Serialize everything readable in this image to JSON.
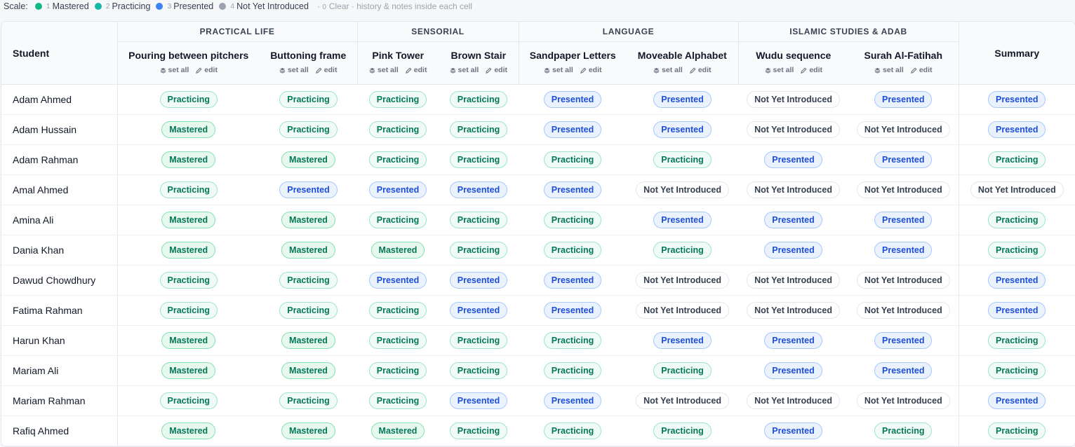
{
  "scale": {
    "label": "Scale:",
    "levels": [
      {
        "num": "1",
        "name": "Mastered",
        "color": "#10b981"
      },
      {
        "num": "2",
        "name": "Practicing",
        "color": "#14b8a6"
      },
      {
        "num": "3",
        "name": "Presented",
        "color": "#3b82f6"
      },
      {
        "num": "4",
        "name": "Not Yet Introduced",
        "color": "#9ca3af"
      }
    ],
    "hint_prefix": "·",
    "hint_key": "0",
    "hint_text": "Clear · history & notes inside each cell"
  },
  "table": {
    "student_header": "Student",
    "summary_header": "Summary",
    "set_all_label": "set all",
    "edit_label": "edit",
    "groups": [
      {
        "name": "PRACTICAL LIFE",
        "activities": [
          "Pouring between pitchers",
          "Buttoning frame"
        ]
      },
      {
        "name": "SENSORIAL",
        "activities": [
          "Pink Tower",
          "Brown Stair"
        ]
      },
      {
        "name": "LANGUAGE",
        "activities": [
          "Sandpaper Letters",
          "Moveable Alphabet"
        ]
      },
      {
        "name": "ISLAMIC STUDIES & ADAB",
        "activities": [
          "Wudu sequence",
          "Surah Al-Fatihah"
        ]
      }
    ],
    "rows": [
      {
        "student": "Adam Ahmed",
        "cells": [
          "Practicing",
          "Practicing",
          "Practicing",
          "Practicing",
          "Presented",
          "Presented",
          "Not Yet Introduced",
          "Presented"
        ],
        "summary": "Presented"
      },
      {
        "student": "Adam Hussain",
        "cells": [
          "Mastered",
          "Practicing",
          "Practicing",
          "Practicing",
          "Presented",
          "Presented",
          "Not Yet Introduced",
          "Not Yet Introduced"
        ],
        "summary": "Presented"
      },
      {
        "student": "Adam Rahman",
        "cells": [
          "Mastered",
          "Mastered",
          "Practicing",
          "Practicing",
          "Practicing",
          "Practicing",
          "Presented",
          "Presented"
        ],
        "summary": "Practicing"
      },
      {
        "student": "Amal Ahmed",
        "cells": [
          "Practicing",
          "Presented",
          "Presented",
          "Presented",
          "Presented",
          "Not Yet Introduced",
          "Not Yet Introduced",
          "Not Yet Introduced"
        ],
        "summary": "Not Yet Introduced"
      },
      {
        "student": "Amina Ali",
        "cells": [
          "Mastered",
          "Mastered",
          "Practicing",
          "Practicing",
          "Practicing",
          "Presented",
          "Presented",
          "Presented"
        ],
        "summary": "Practicing"
      },
      {
        "student": "Dania Khan",
        "cells": [
          "Mastered",
          "Mastered",
          "Mastered",
          "Practicing",
          "Practicing",
          "Practicing",
          "Presented",
          "Presented"
        ],
        "summary": "Practicing"
      },
      {
        "student": "Dawud Chowdhury",
        "cells": [
          "Practicing",
          "Practicing",
          "Presented",
          "Presented",
          "Presented",
          "Not Yet Introduced",
          "Not Yet Introduced",
          "Not Yet Introduced"
        ],
        "summary": "Presented"
      },
      {
        "student": "Fatima Rahman",
        "cells": [
          "Practicing",
          "Practicing",
          "Practicing",
          "Presented",
          "Presented",
          "Not Yet Introduced",
          "Not Yet Introduced",
          "Not Yet Introduced"
        ],
        "summary": "Presented"
      },
      {
        "student": "Harun Khan",
        "cells": [
          "Mastered",
          "Mastered",
          "Practicing",
          "Practicing",
          "Practicing",
          "Presented",
          "Presented",
          "Presented"
        ],
        "summary": "Practicing"
      },
      {
        "student": "Mariam Ali",
        "cells": [
          "Mastered",
          "Mastered",
          "Practicing",
          "Practicing",
          "Practicing",
          "Practicing",
          "Presented",
          "Presented"
        ],
        "summary": "Practicing"
      },
      {
        "student": "Mariam Rahman",
        "cells": [
          "Practicing",
          "Practicing",
          "Practicing",
          "Presented",
          "Presented",
          "Not Yet Introduced",
          "Not Yet Introduced",
          "Not Yet Introduced"
        ],
        "summary": "Presented"
      },
      {
        "student": "Rafiq Ahmed",
        "cells": [
          "Mastered",
          "Mastered",
          "Mastered",
          "Practicing",
          "Practicing",
          "Practicing",
          "Presented",
          "Practicing"
        ],
        "summary": "Practicing"
      }
    ]
  }
}
